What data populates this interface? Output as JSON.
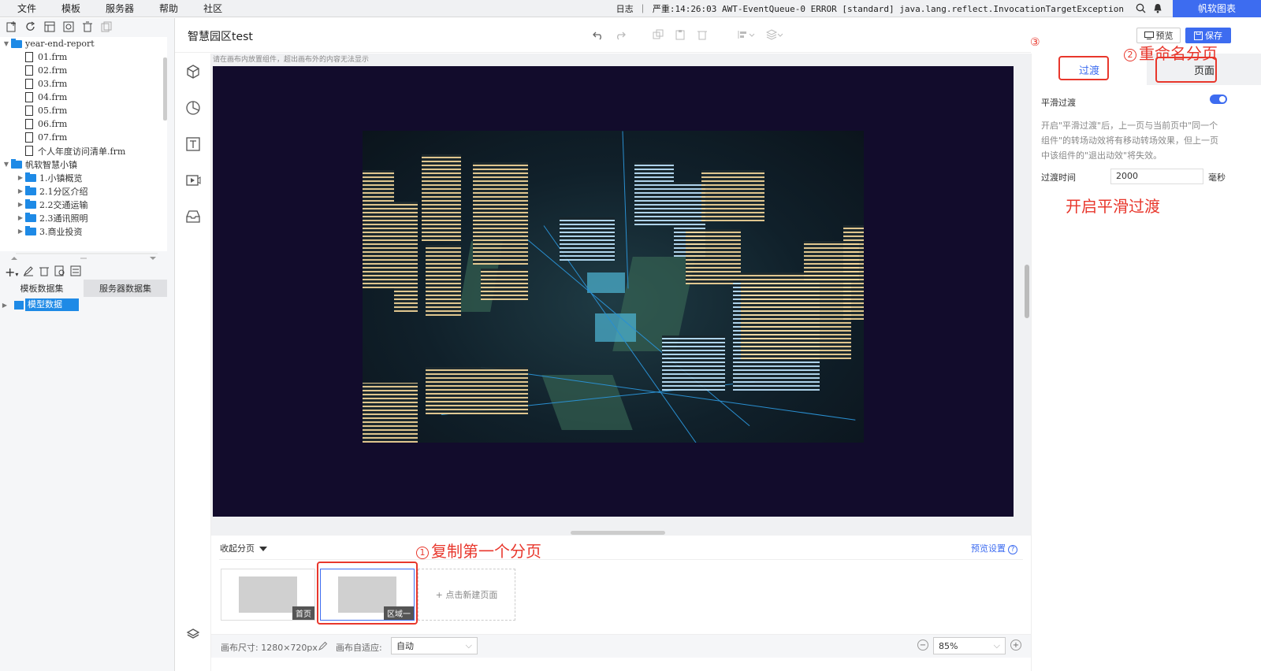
{
  "menubar": {
    "items": [
      "文件",
      "模板",
      "服务器",
      "帮助",
      "社区"
    ],
    "log_text": "日志 ｜ 严重:14:26:03 AWT-EventQueue-0 ERROR [standard] java.lang.reflect.InvocationTargetException",
    "brand": "帆软图表"
  },
  "tree": {
    "items": [
      {
        "label": "year-end-report",
        "type": "folder",
        "level": 0,
        "expanded": true
      },
      {
        "label": "01.frm",
        "type": "file",
        "level": 1
      },
      {
        "label": "02.frm",
        "type": "file",
        "level": 1
      },
      {
        "label": "03.frm",
        "type": "file",
        "level": 1
      },
      {
        "label": "04.frm",
        "type": "file",
        "level": 1
      },
      {
        "label": "05.frm",
        "type": "file",
        "level": 1
      },
      {
        "label": "06.frm",
        "type": "file",
        "level": 1
      },
      {
        "label": "07.frm",
        "type": "file",
        "level": 1
      },
      {
        "label": "个人年度访问清单.frm",
        "type": "file",
        "level": 1
      },
      {
        "label": "帆软智慧小镇",
        "type": "folder",
        "level": 0,
        "expanded": true
      },
      {
        "label": "1.小镇概览",
        "type": "folder",
        "level": 1
      },
      {
        "label": "2.1分区介绍",
        "type": "folder",
        "level": 1
      },
      {
        "label": "2.2交通运输",
        "type": "folder",
        "level": 1
      },
      {
        "label": "2.3通讯照明",
        "type": "folder",
        "level": 1
      },
      {
        "label": "3.商业投资",
        "type": "folder",
        "level": 1
      }
    ]
  },
  "dataset_tabs": [
    "模板数据集",
    "服务器数据集"
  ],
  "dataset_item": "模型数据",
  "header": {
    "title": "智慧园区test",
    "preview": "预览",
    "save": "保存"
  },
  "canvas": {
    "hint": "请在画布内放置组件，超出画布外的内容无法显示",
    "bg_color": "#120c2c"
  },
  "pages": {
    "collapse": "收起分页",
    "settings": "预览设置",
    "thumbs": [
      {
        "label": "首页",
        "selected": false
      },
      {
        "label": "区域一",
        "selected": true
      }
    ],
    "new_page": "+ 点击新建页面"
  },
  "footer": {
    "size_label": "画布尺寸: 1280×720px",
    "adapt_label": "画布自适应:",
    "adapt_value": "自动",
    "zoom": "85%"
  },
  "rpanel": {
    "tabs": [
      "过渡",
      "页面"
    ],
    "smooth_label": "平滑过渡",
    "smooth_on": true,
    "desc": "开启\"平滑过渡\"后，上一页与当前页中\"同一个组件\"的转场动效将有移动转场效果，但上一页中该组件的\"退出动效\"将失效。",
    "duration_label": "过渡时间",
    "duration_value": "2000",
    "duration_unit": "毫秒"
  },
  "annotations": {
    "a1": "复制第一个分页",
    "a2": "重命名分页",
    "a3": "③",
    "a4": "开启平滑过渡"
  },
  "colors": {
    "accent": "#3d6cf0",
    "annotation": "#e8372c",
    "folder": "#1e8ae6"
  }
}
